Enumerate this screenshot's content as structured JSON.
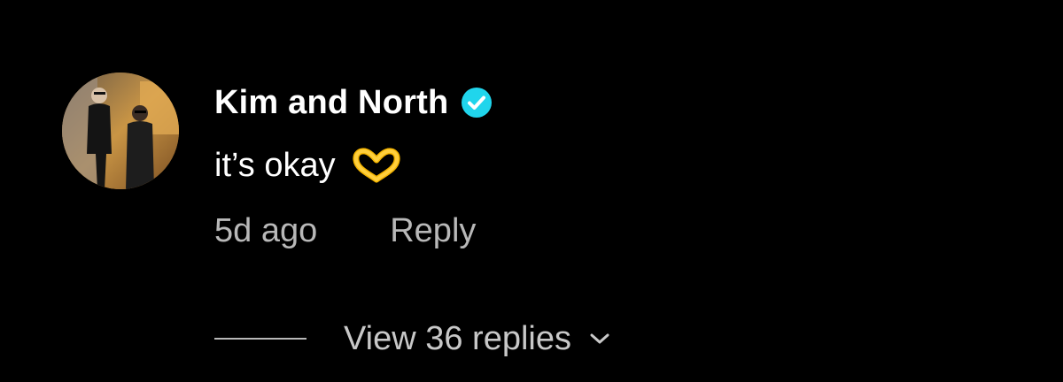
{
  "comment": {
    "avatar_icon": "avatar-photo",
    "username": "Kim and North",
    "verified_icon": "verified-badge-icon",
    "verified_color": "#20d5ec",
    "text": "it’s okay",
    "emoji_icon": "heart-hands-emoji",
    "timestamp": "5d ago",
    "reply_label": "Reply",
    "view_replies_label": "View 36 replies",
    "expand_icon": "chevron-down-icon"
  }
}
